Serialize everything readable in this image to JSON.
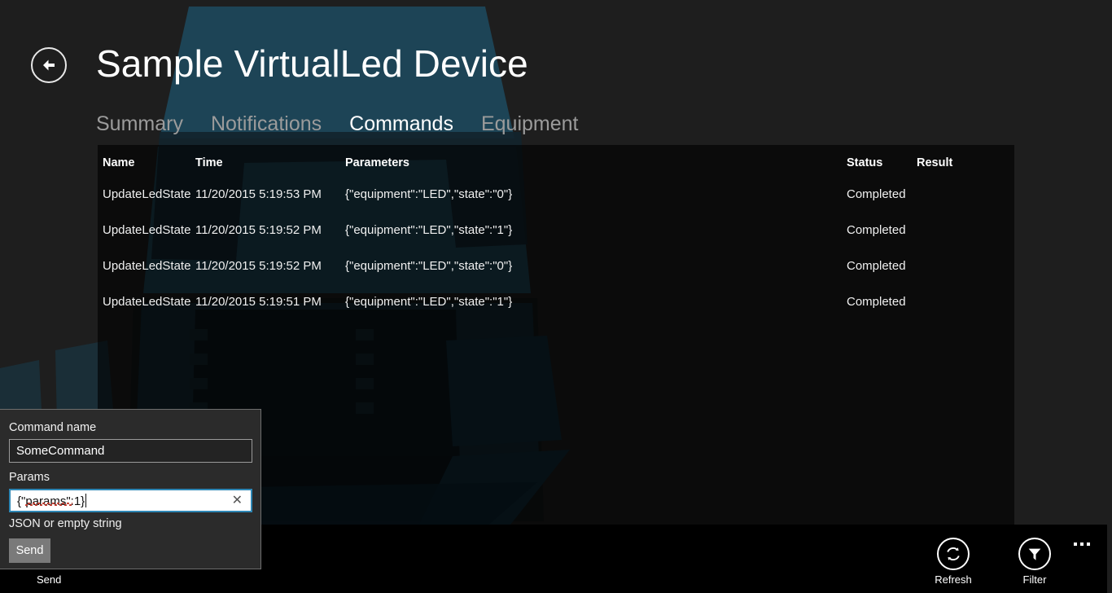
{
  "header": {
    "back_icon": "back-arrow-icon",
    "title": "Sample VirtualLed Device"
  },
  "tabs": [
    {
      "label": "Summary",
      "active": false
    },
    {
      "label": "Notifications",
      "active": false
    },
    {
      "label": "Commands",
      "active": true
    },
    {
      "label": "Equipment",
      "active": false
    }
  ],
  "table": {
    "columns": [
      "Name",
      "Time",
      "Parameters",
      "Status",
      "Result"
    ],
    "rows": [
      {
        "name": "UpdateLedState",
        "time": "11/20/2015 5:19:53 PM",
        "parameters": "{\"equipment\":\"LED\",\"state\":\"0\"}",
        "status": "Completed",
        "result": ""
      },
      {
        "name": "UpdateLedState",
        "time": "11/20/2015 5:19:52 PM",
        "parameters": "{\"equipment\":\"LED\",\"state\":\"1\"}",
        "status": "Completed",
        "result": ""
      },
      {
        "name": "UpdateLedState",
        "time": "11/20/2015 5:19:52 PM",
        "parameters": "{\"equipment\":\"LED\",\"state\":\"0\"}",
        "status": "Completed",
        "result": ""
      },
      {
        "name": "UpdateLedState",
        "time": "11/20/2015 5:19:51 PM",
        "parameters": "{\"equipment\":\"LED\",\"state\":\"1\"}",
        "status": "Completed",
        "result": ""
      }
    ]
  },
  "flyout": {
    "command_name_label": "Command name",
    "command_name_value": "SomeCommand",
    "params_label": "Params",
    "params_value": "{\"params\":1}",
    "params_helper": "JSON or empty string",
    "clear_icon": "close-icon",
    "send_label": "Send"
  },
  "appbar": {
    "send_label": "Send",
    "refresh_label": "Refresh",
    "refresh_icon": "refresh-icon",
    "filter_label": "Filter",
    "filter_icon": "funnel-icon",
    "overflow_icon": "ellipsis-icon"
  },
  "colors": {
    "page_background": "#1e1e1e",
    "artwork_teal": "#1d4456",
    "artwork_teal_dark": "#0d2430",
    "table_overlay": "#060606",
    "accent_focus": "#2e87b5",
    "appbar_background": "#000000",
    "active_tab_text": "#ffffff",
    "inactive_tab_text": "#9b9b9b",
    "spellcheck_underline": "#c0392b"
  }
}
